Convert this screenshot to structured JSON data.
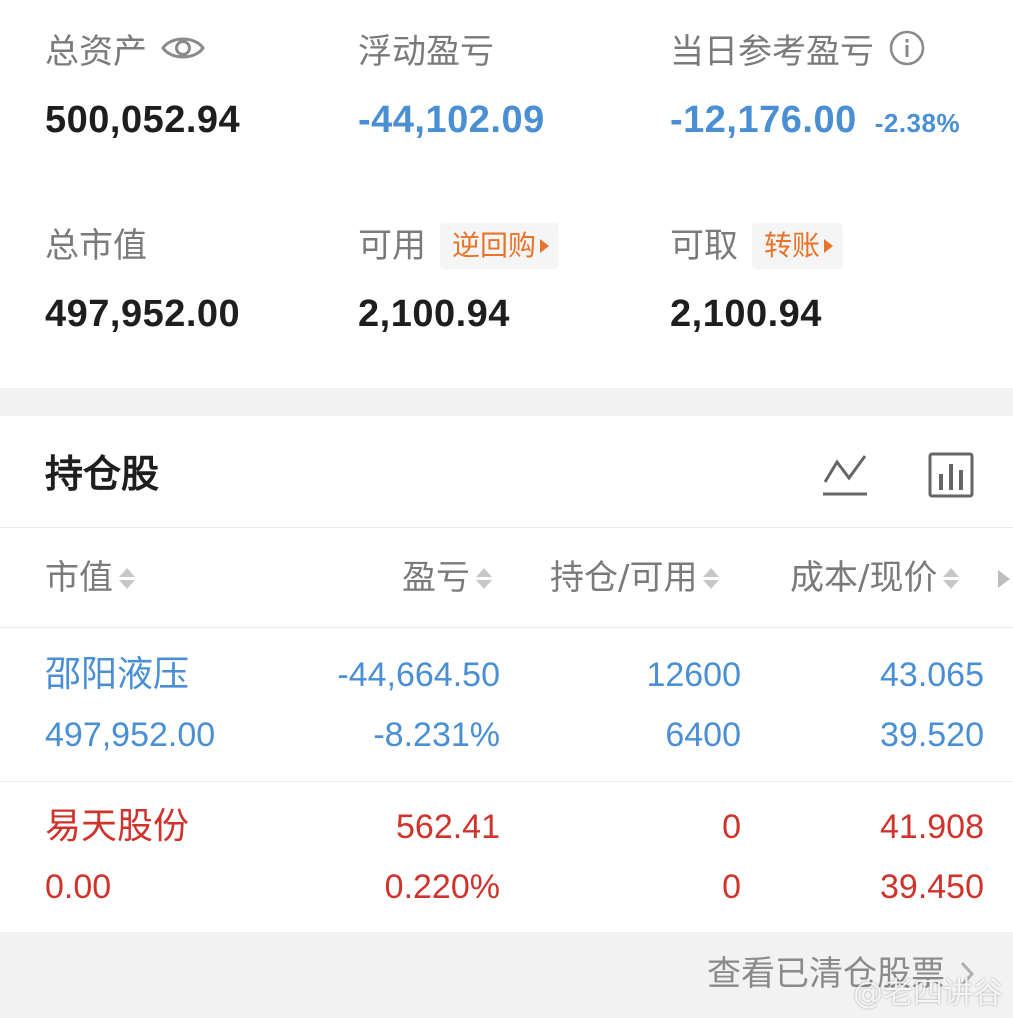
{
  "summary": {
    "total_assets": {
      "label": "总资产",
      "value": "500,052.94"
    },
    "floating_pl": {
      "label": "浮动盈亏",
      "value": "-44,102.09"
    },
    "daily_pl": {
      "label": "当日参考盈亏",
      "value": "-12,176.00",
      "pct": "-2.38%"
    },
    "market_value": {
      "label": "总市值",
      "value": "497,952.00"
    },
    "available": {
      "label": "可用",
      "value": "2,100.94",
      "action": "逆回购"
    },
    "withdrawable": {
      "label": "可取",
      "value": "2,100.94",
      "action": "转账"
    }
  },
  "holdings": {
    "title": "持仓股",
    "columns": [
      "市值",
      "盈亏",
      "持仓/可用",
      "成本/现价"
    ],
    "rows": [
      {
        "name": "邵阳液压",
        "market_value": "497,952.00",
        "pl": "-44,664.50",
        "pl_pct": "-8.231%",
        "position": "12600",
        "available": "6400",
        "cost": "43.065",
        "price": "39.520"
      },
      {
        "name": "易天股份",
        "market_value": "0.00",
        "pl": "562.41",
        "pl_pct": "0.220%",
        "position": "0",
        "available": "0",
        "cost": "41.908",
        "price": "39.450"
      }
    ]
  },
  "footer": {
    "link": "查看已清仓股票"
  },
  "watermark": "@老四讲谷",
  "colors": {
    "loss": "#4a8fd4",
    "gain": "#d0332b",
    "accent": "#e8742c"
  },
  "icons": [
    "eye-icon",
    "info-icon",
    "line-chart-icon",
    "bar-chart-icon",
    "chevron-right-icon"
  ]
}
